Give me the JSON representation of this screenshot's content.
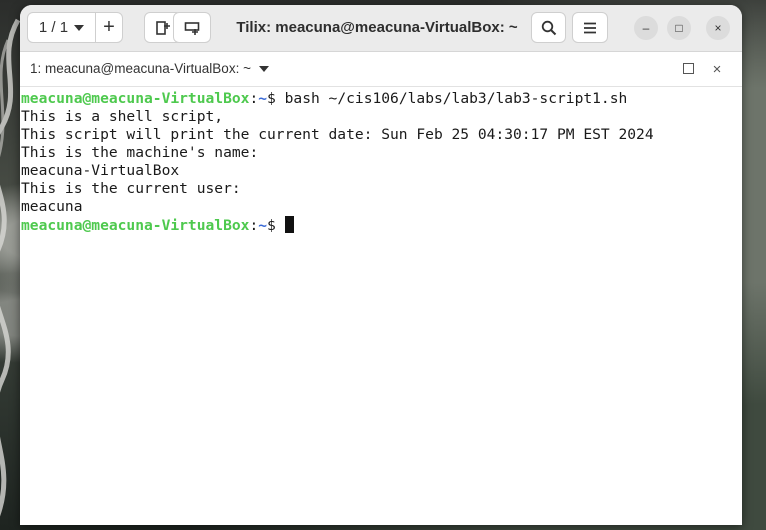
{
  "window": {
    "title": "Tilix: meacuna@meacuna-VirtualBox: ~"
  },
  "toolbar": {
    "session_counter": "1 / 1",
    "add_label": "+",
    "search_icon": "search-icon",
    "menu_icon": "hamburger-menu-icon",
    "new_session_icon": "add-terminal-icon",
    "split_icon": "split-terminal-icon"
  },
  "window_controls": {
    "minimize": "–",
    "maximize": "□",
    "close": "×"
  },
  "terminal": {
    "tab_label": "1: meacuna@meacuna-VirtualBox: ~",
    "close_label": "×",
    "colors": {
      "prompt_user": "#4ec94e",
      "prompt_path": "#3a6ad6",
      "text": "#1a1a1a"
    },
    "lines": [
      {
        "type": "prompt",
        "user": "meacuna@meacuna-VirtualBox",
        "sep": ":",
        "path": "~",
        "symbol": "$ ",
        "command": "bash ~/cis106/labs/lab3/lab3-script1.sh"
      },
      {
        "type": "output",
        "text": "This is a shell script,"
      },
      {
        "type": "output",
        "text": "This script will print the current date: Sun Feb 25 04:30:17 PM EST 2024"
      },
      {
        "type": "output",
        "text": "This is the machine's name:"
      },
      {
        "type": "output",
        "text": "meacuna-VirtualBox"
      },
      {
        "type": "output",
        "text": "This is the current user:"
      },
      {
        "type": "output",
        "text": "meacuna"
      },
      {
        "type": "prompt",
        "user": "meacuna@meacuna-VirtualBox",
        "sep": ":",
        "path": "~",
        "symbol": "$ ",
        "command": ""
      }
    ]
  }
}
